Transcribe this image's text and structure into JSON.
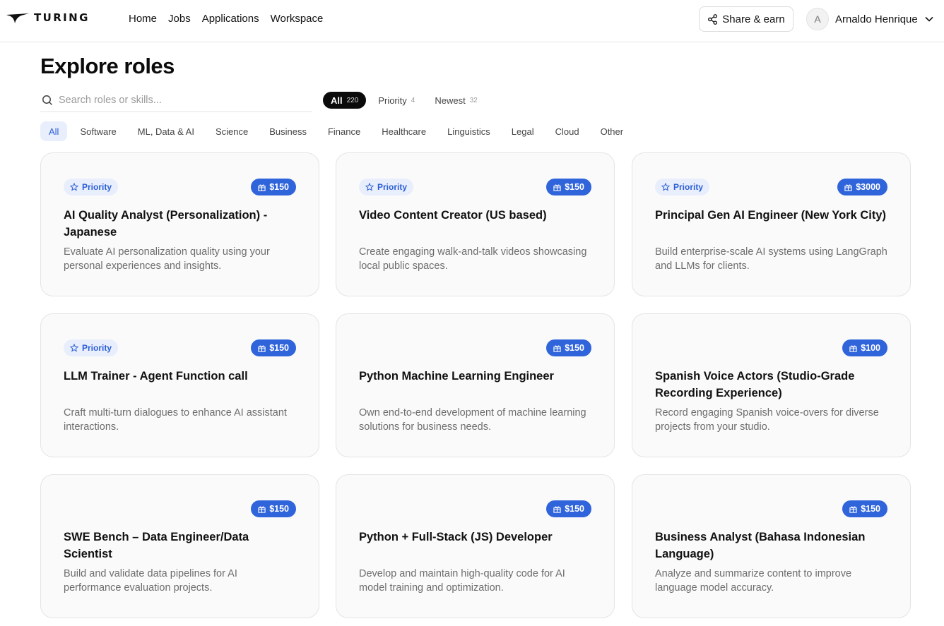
{
  "brand": {
    "name": "TURING"
  },
  "nav": {
    "items": [
      "Home",
      "Jobs",
      "Applications",
      "Workspace"
    ]
  },
  "header": {
    "share_label": "Share & earn",
    "user_initial": "A",
    "user_name": "Arnaldo Henrique"
  },
  "page": {
    "title": "Explore roles"
  },
  "search": {
    "placeholder": "Search roles or skills...",
    "value": ""
  },
  "sort_tabs": [
    {
      "label": "All",
      "count": "220",
      "active": true
    },
    {
      "label": "Priority",
      "count": "4",
      "active": false
    },
    {
      "label": "Newest",
      "count": "32",
      "active": false
    }
  ],
  "categories": [
    {
      "label": "All",
      "active": true
    },
    {
      "label": "Software",
      "active": false
    },
    {
      "label": "ML, Data & AI",
      "active": false
    },
    {
      "label": "Science",
      "active": false
    },
    {
      "label": "Business",
      "active": false
    },
    {
      "label": "Finance",
      "active": false
    },
    {
      "label": "Healthcare",
      "active": false
    },
    {
      "label": "Linguistics",
      "active": false
    },
    {
      "label": "Legal",
      "active": false
    },
    {
      "label": "Cloud",
      "active": false
    },
    {
      "label": "Other",
      "active": false
    }
  ],
  "priority_label": "Priority",
  "colors": {
    "accent": "#2f64db",
    "chip_bg": "#e8eefc",
    "dark_pill": "#0b0b0b"
  },
  "roles": [
    {
      "priority": true,
      "reward": "$150",
      "title": "AI Quality Analyst (Personalization) - Japanese",
      "description": "Evaluate AI personalization quality using your personal experiences and insights."
    },
    {
      "priority": true,
      "reward": "$150",
      "title": "Video Content Creator (US based)",
      "description": "Create engaging walk-and-talk videos showcasing local public spaces."
    },
    {
      "priority": true,
      "reward": "$3000",
      "title": "Principal Gen AI Engineer (New York City)",
      "description": "Build enterprise-scale AI systems using LangGraph and LLMs for clients."
    },
    {
      "priority": true,
      "reward": "$150",
      "title": "LLM Trainer - Agent Function call",
      "description": "Craft multi-turn dialogues to enhance AI assistant interactions."
    },
    {
      "priority": false,
      "reward": "$150",
      "title": "Python Machine Learning Engineer",
      "description": "Own end-to-end development of machine learning solutions for business needs."
    },
    {
      "priority": false,
      "reward": "$100",
      "title": "Spanish Voice Actors (Studio-Grade Recording Experience)",
      "description": "Record engaging Spanish voice-overs for diverse projects from your studio."
    },
    {
      "priority": false,
      "reward": "$150",
      "title": "SWE Bench – Data Engineer/Data Scientist",
      "description": "Build and validate data pipelines for AI performance evaluation projects."
    },
    {
      "priority": false,
      "reward": "$150",
      "title": "Python + Full-Stack (JS) Developer",
      "description": "Develop and maintain high-quality code for AI model training and optimization."
    },
    {
      "priority": false,
      "reward": "$150",
      "title": "Business Analyst (Bahasa Indonesian Language)",
      "description": "Analyze and summarize content to improve language model accuracy."
    }
  ]
}
